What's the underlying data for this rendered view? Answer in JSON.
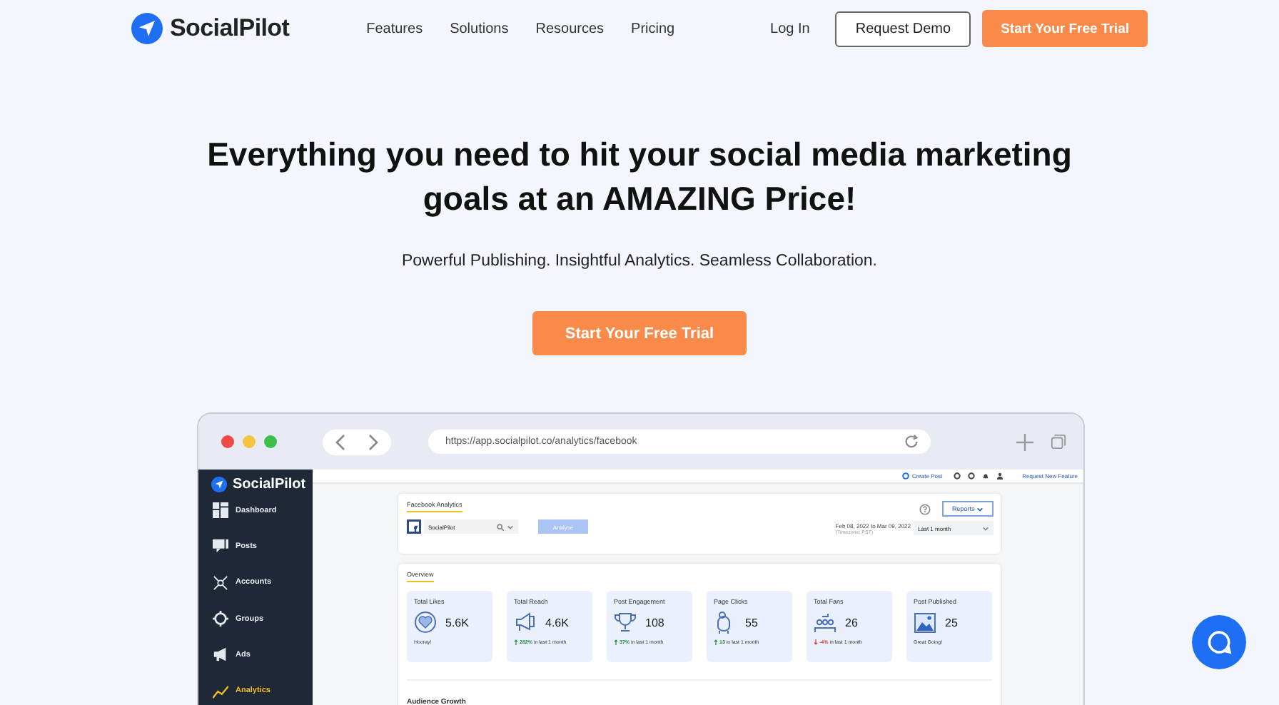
{
  "nav": {
    "brand": "SocialPilot",
    "links": [
      "Features",
      "Solutions",
      "Resources",
      "Pricing"
    ],
    "login": "Log In",
    "demo": "Request Demo",
    "trial": "Start Your Free Trial"
  },
  "hero": {
    "title": "Everything you need to hit your social media marketing goals at an AMAZING Price!",
    "subtitle": "Powerful Publishing. Insightful Analytics. Seamless Collaboration.",
    "cta": "Start Your Free Trial"
  },
  "browser": {
    "url": "https://app.socialpilot.co/analytics/facebook",
    "app": {
      "brand": "SocialPilot",
      "create_post": "Create Post",
      "request_feature": "Request New Feature",
      "sidebar": [
        {
          "label": "Dashboard",
          "selected": false
        },
        {
          "label": "Posts",
          "selected": false
        },
        {
          "label": "Accounts",
          "selected": false
        },
        {
          "label": "Groups",
          "selected": false
        },
        {
          "label": "Ads",
          "selected": false
        },
        {
          "label": "Analytics",
          "selected": true
        }
      ],
      "analytics": {
        "tab": "Facebook Analytics",
        "account": "SocialPilot",
        "analyse": "Analyse",
        "reports": "Reports",
        "date_range": "Feb 08, 2022 to Mar 09, 2022",
        "timezone": "(Timezone: PST)",
        "period": "Last 1 month"
      },
      "overview": {
        "tab": "Overview",
        "stats": [
          {
            "label": "Total Likes",
            "value": "5.6K",
            "note": "Hooray!"
          },
          {
            "label": "Total Reach",
            "value": "4.6K",
            "change": {
              "kind": "up",
              "amount": "282%",
              "text": "in last 1 month"
            }
          },
          {
            "label": "Post Engagement",
            "value": "108",
            "change": {
              "kind": "up",
              "amount": "37%",
              "text": "in last 1 month"
            }
          },
          {
            "label": "Page Clicks",
            "value": "55",
            "change": {
              "kind": "up",
              "amount": "13",
              "text": "in last 1 month"
            }
          },
          {
            "label": "Total Fans",
            "value": "26",
            "change": {
              "kind": "down",
              "amount": "-4%",
              "text": "in last 1 month"
            }
          },
          {
            "label": "Post Published",
            "value": "25",
            "note": "Great Going!"
          }
        ]
      },
      "section": "Audience Growth"
    }
  }
}
